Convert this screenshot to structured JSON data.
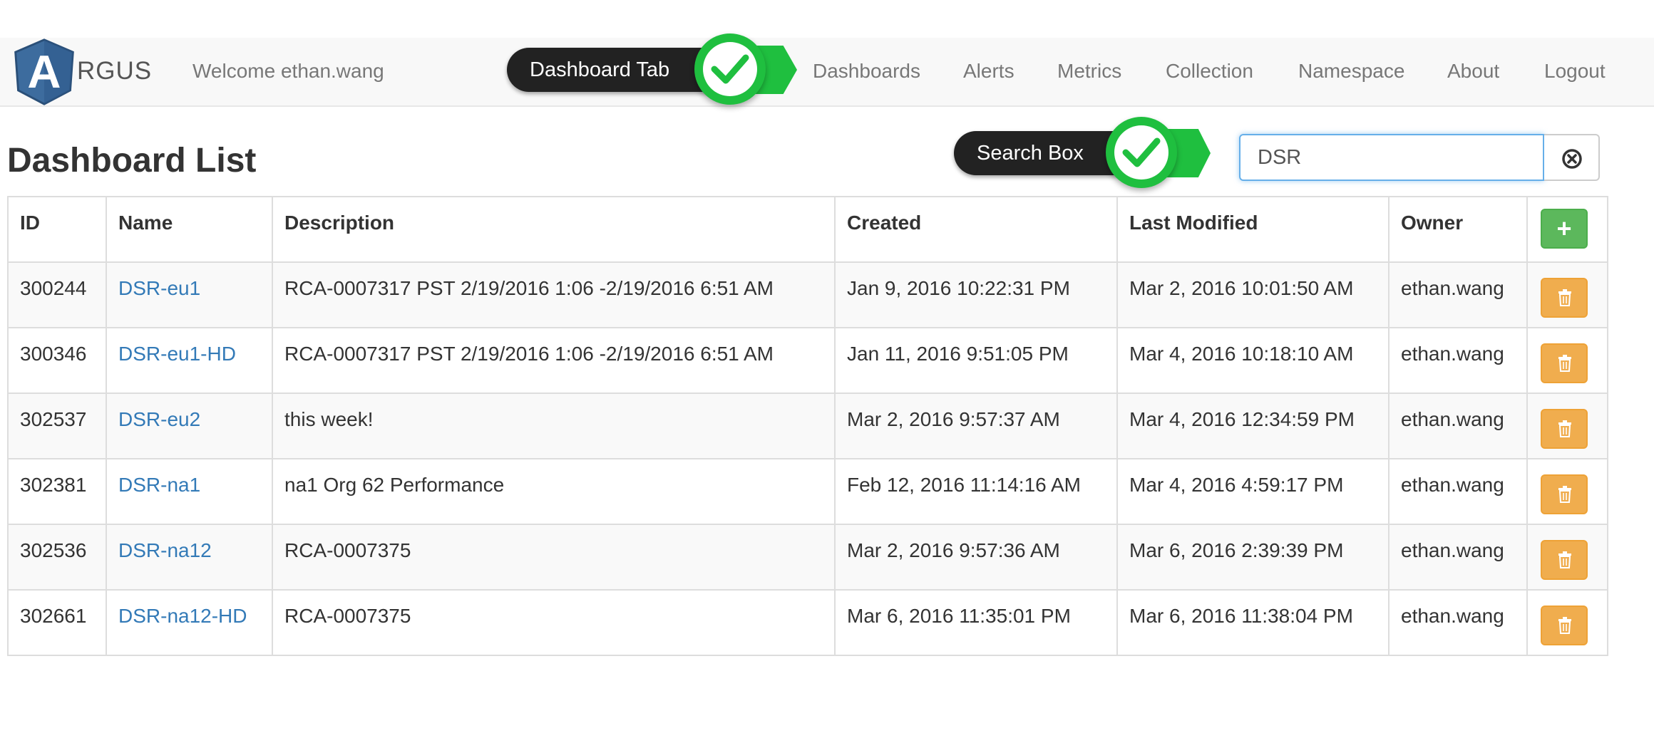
{
  "navbar": {
    "brand_letter": "A",
    "brand_text": "RGUS",
    "welcome": "Welcome ethan.wang",
    "links": [
      {
        "label": "Dashboards"
      },
      {
        "label": "Alerts"
      },
      {
        "label": "Metrics"
      },
      {
        "label": "Collection"
      },
      {
        "label": "Namespace"
      },
      {
        "label": "About"
      },
      {
        "label": "Logout"
      }
    ]
  },
  "callouts": {
    "dashboard_tab": "Dashboard Tab",
    "search_box": "Search Box"
  },
  "page": {
    "title": "Dashboard List"
  },
  "search": {
    "value": "DSR",
    "placeholder": ""
  },
  "table": {
    "headers": {
      "id": "ID",
      "name": "Name",
      "description": "Description",
      "created": "Created",
      "modified": "Last Modified",
      "owner": "Owner",
      "add": "+"
    },
    "rows": [
      {
        "id": "300244",
        "name": "DSR-eu1",
        "description": "RCA-0007317 PST 2/19/2016 1:06 -2/19/2016 6:51 AM",
        "created": "Jan 9, 2016 10:22:31 PM",
        "modified": "Mar 2, 2016 10:01:50 AM",
        "owner": "ethan.wang"
      },
      {
        "id": "300346",
        "name": "DSR-eu1-HD",
        "description": "RCA-0007317 PST 2/19/2016 1:06 -2/19/2016 6:51 AM",
        "created": "Jan 11, 2016 9:51:05 PM",
        "modified": "Mar 4, 2016 10:18:10 AM",
        "owner": "ethan.wang"
      },
      {
        "id": "302537",
        "name": "DSR-eu2",
        "description": "this week!",
        "created": "Mar 2, 2016 9:57:37 AM",
        "modified": "Mar 4, 2016 12:34:59 PM",
        "owner": "ethan.wang"
      },
      {
        "id": "302381",
        "name": "DSR-na1",
        "description": "na1 Org 62 Performance",
        "created": "Feb 12, 2016 11:14:16 AM",
        "modified": "Mar 4, 2016 4:59:17 PM",
        "owner": "ethan.wang"
      },
      {
        "id": "302536",
        "name": "DSR-na12",
        "description": "RCA-0007375",
        "created": "Mar 2, 2016 9:57:36 AM",
        "modified": "Mar 6, 2016 2:39:39 PM",
        "owner": "ethan.wang"
      },
      {
        "id": "302661",
        "name": "DSR-na12-HD",
        "description": "RCA-0007375",
        "created": "Mar 6, 2016 11:35:01 PM",
        "modified": "Mar 6, 2016 11:38:04 PM",
        "owner": "ethan.wang"
      }
    ]
  },
  "colors": {
    "link": "#337ab7",
    "add_button": "#5cb85c",
    "delete_button": "#f0ad4e",
    "callout_green": "#1fbf3f",
    "callout_dark": "#222222"
  }
}
